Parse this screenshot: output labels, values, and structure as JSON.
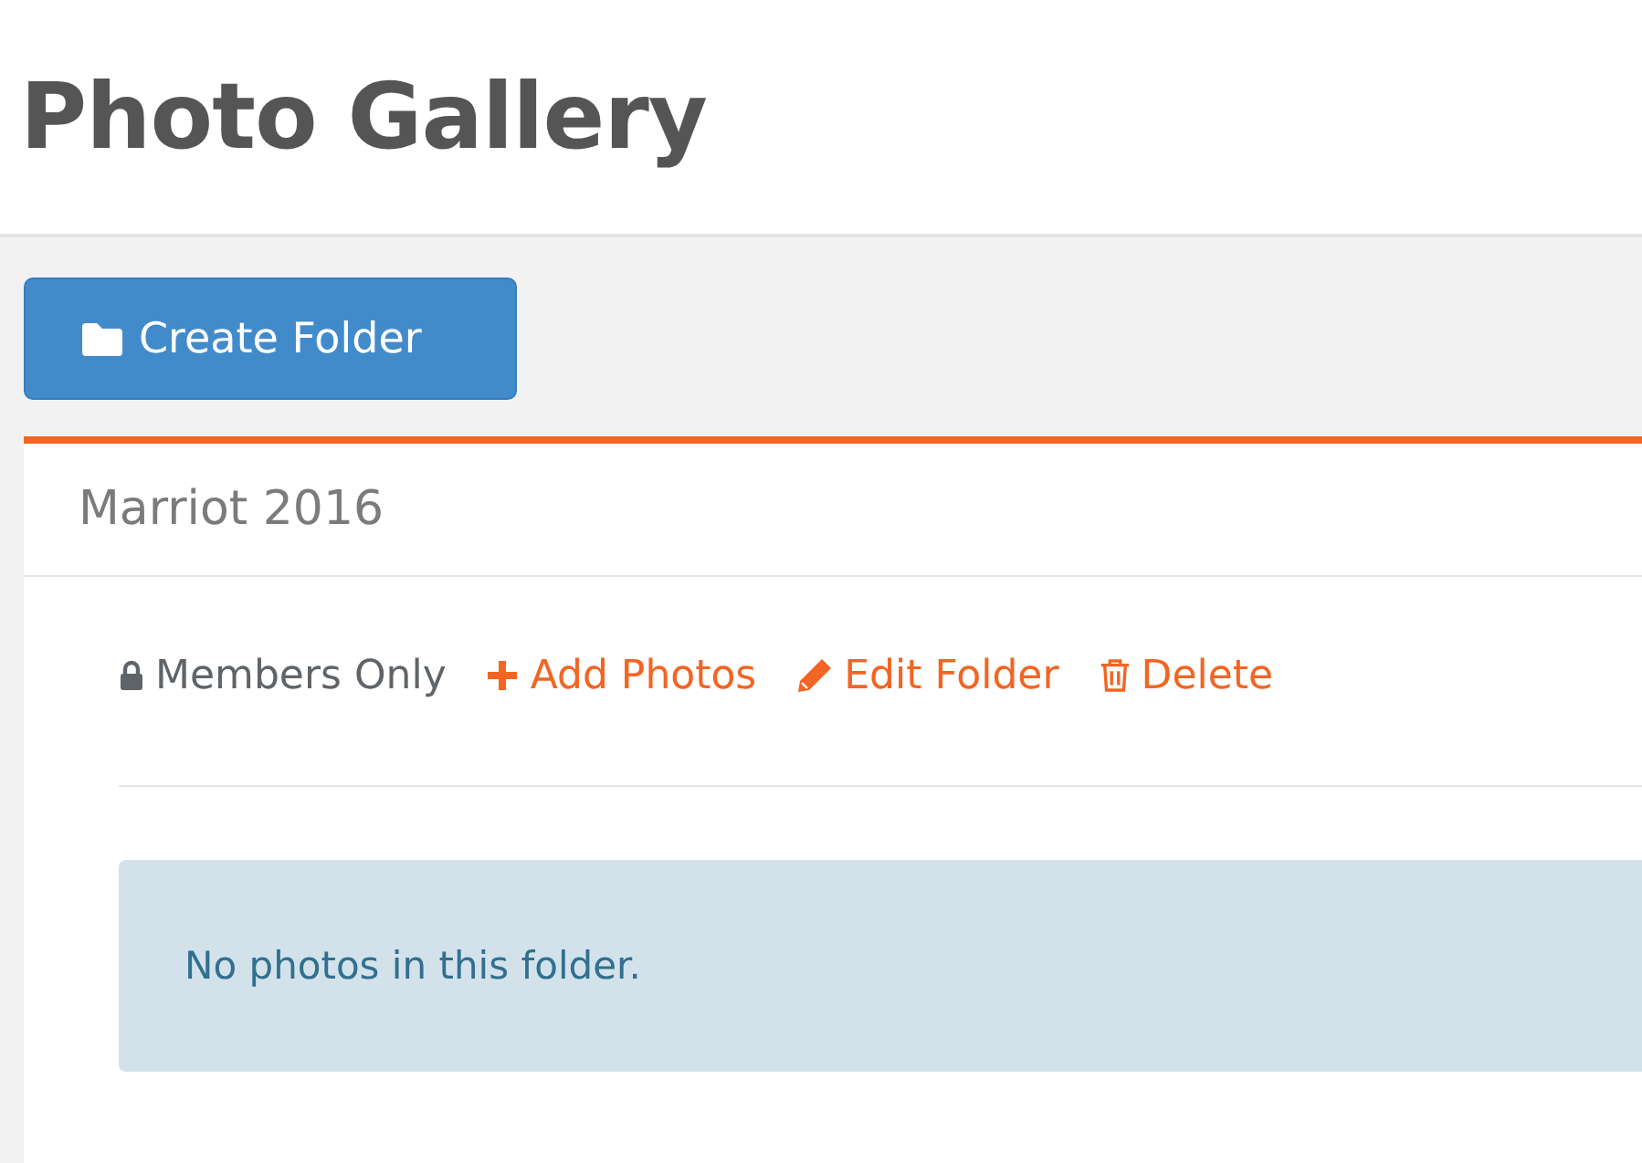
{
  "page": {
    "title": "Photo Gallery"
  },
  "create_button": {
    "label": "Create Folder"
  },
  "folder": {
    "title": "Marriot 2016",
    "actions": [
      {
        "kind": "visibility",
        "label": "Members Only"
      },
      {
        "kind": "add",
        "label": "Add Photos"
      },
      {
        "kind": "edit",
        "label": "Edit Folder"
      },
      {
        "kind": "delete",
        "label": "Delete"
      }
    ],
    "empty_message": "No photos in this folder."
  }
}
